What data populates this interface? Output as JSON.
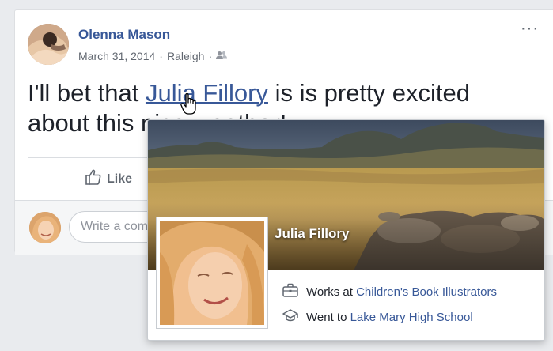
{
  "post": {
    "author": "Olenna Mason",
    "date": "March 31, 2014",
    "location": "Raleigh",
    "separator": "·",
    "audience_icon": "friends-icon",
    "more_icon": "more-options-icon",
    "text_before": "I'll bet that ",
    "mention": "Julia Fillory",
    "text_after": " is is pretty excited about this nice weather!",
    "like_label": "Like",
    "comment_placeholder": "Write a comment..."
  },
  "hover_card": {
    "name": "Julia Fillory",
    "work_prefix": "Works at",
    "work_place": "Children's Book Illustrators",
    "school_prefix": "Went to",
    "school_name": "Lake Mary High School",
    "work_icon": "briefcase-icon",
    "school_icon": "graduation-cap-icon"
  },
  "colors": {
    "link": "#385898",
    "text": "#1d2129",
    "meta": "#616770",
    "background": "#e9ebee"
  }
}
